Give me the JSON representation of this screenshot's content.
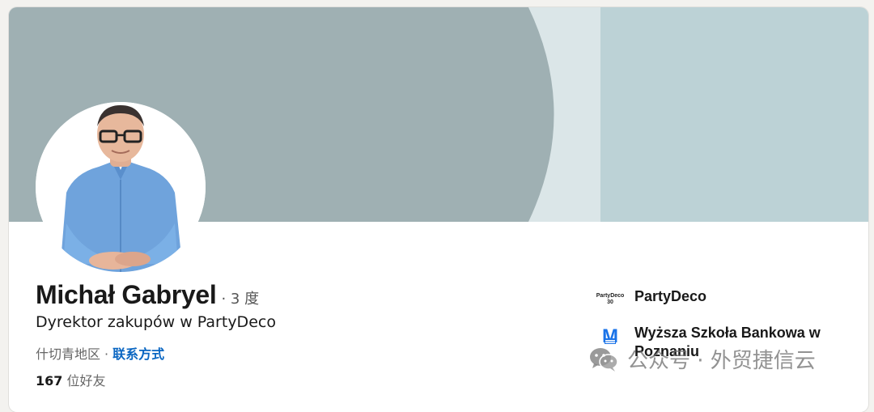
{
  "profile": {
    "name": "Michał Gabryel",
    "degree": "· 3 度",
    "headline": "Dyrektor zakupów w PartyDeco",
    "location": "什切青地区",
    "separator": "·",
    "contact_info": "联系方式",
    "connections_count": "167",
    "connections_label": "位好友"
  },
  "organizations": [
    {
      "name": "PartyDeco",
      "logo_line1": "PartyDeco",
      "logo_line2": "30",
      "icon": "partydeco-logo"
    },
    {
      "name": "Wyższa Szkoła Bankowa w Poznaniu",
      "logo_letter": "M",
      "icon": "wsb-logo"
    }
  ],
  "watermark": {
    "text": "公众号 · 外贸捷信云",
    "icon": "wechat-icon"
  },
  "colors": {
    "cover_main": "#9fb0b3",
    "cover_light": "#dbe6e8",
    "cover_right": "#bcd2d6",
    "link": "#0a66c2",
    "shirt": "#6fa3dc"
  }
}
